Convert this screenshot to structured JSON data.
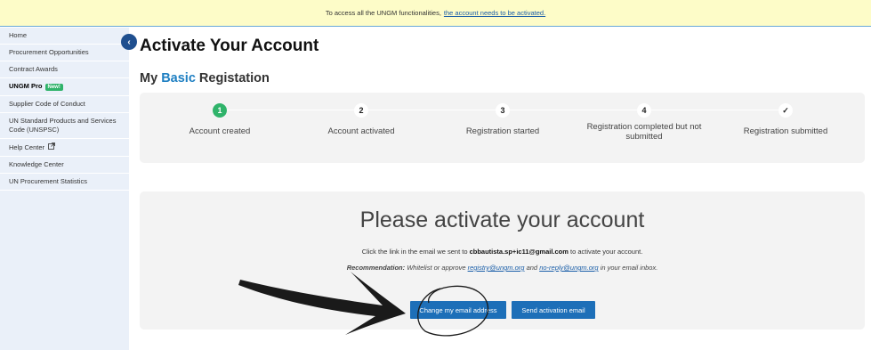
{
  "banner": {
    "text": "To access all the UNGM functionalities,",
    "link": "the account needs to be activated."
  },
  "sidebar": {
    "items": [
      {
        "label": "Home"
      },
      {
        "label": "Procurement Opportunities"
      },
      {
        "label": "Contract Awards"
      },
      {
        "label": "UNGM Pro",
        "badge": "New!"
      },
      {
        "label": "Supplier Code of Conduct"
      },
      {
        "label": "UN Standard Products and Services Code (UNSPSC)"
      },
      {
        "label": "Help Center"
      },
      {
        "label": "Knowledge Center"
      },
      {
        "label": "UN Procurement Statistics"
      }
    ],
    "collapse_icon": "chevron-left-icon"
  },
  "page": {
    "title": "Activate Your Account",
    "subtitle_prefix": "My",
    "subtitle_accent": "Basic",
    "subtitle_suffix": "Registation",
    "accent_color": "#1e7fc2"
  },
  "steps": [
    {
      "number": "1",
      "label": "Account created",
      "active": true
    },
    {
      "number": "2",
      "label": "Account activated"
    },
    {
      "number": "3",
      "label": "Registration started"
    },
    {
      "number": "4",
      "label": "Registration completed but not submitted"
    },
    {
      "number": "✓",
      "label": "Registration submitted"
    }
  ],
  "activation": {
    "heading": "Please activate your account",
    "msg_before": "Click the link in the email we sent to",
    "email": "cbbautista.sp+ic11@gmail.com",
    "msg_after": "to activate your account.",
    "rec_label": "Recommendation:",
    "rec_text": "Whitelist or approve",
    "rec_email1": "registry@ungm.org",
    "rec_and": "and",
    "rec_email2": "no-reply@ungm.org",
    "rec_end": "in your email inbox.",
    "change_button": "Change my email address",
    "send_button": "Send activation email",
    "button_color": "#1d6fb8"
  }
}
